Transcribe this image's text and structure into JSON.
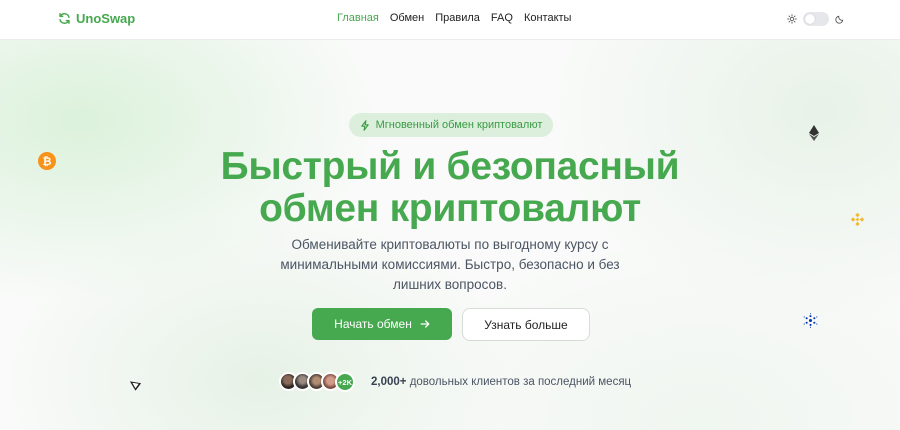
{
  "brand": {
    "name": "UnoSwap",
    "accent": "#47a94f"
  },
  "nav": {
    "items": [
      {
        "label": "Главная",
        "active": true
      },
      {
        "label": "Обмен",
        "active": false
      },
      {
        "label": "Правила",
        "active": false
      },
      {
        "label": "FAQ",
        "active": false
      },
      {
        "label": "Контакты",
        "active": false
      }
    ]
  },
  "theme_toggle": {
    "icons": [
      "sun-icon",
      "moon-icon"
    ],
    "dark_mode": false
  },
  "hero": {
    "badge": "Мгновенный обмен криптовалют",
    "badge_icon": "lightning-icon",
    "title_line1": "Быстрый и безопасный",
    "title_line2": "обмен криптовалют",
    "subtitle": "Обменивайте криптовалюты по выгодному курсу с минимальными комиссиями. Быстро, безопасно и без лишних вопросов.",
    "primary_button": "Начать обмен",
    "secondary_button": "Узнать больше"
  },
  "social_proof": {
    "avatar_count_badge": "+2K",
    "count": "2,000+",
    "text": "довольных клиентов за последний месяц"
  },
  "floating_icons": [
    "bitcoin-icon",
    "ethereum-icon",
    "bnb-icon",
    "cardano-icon",
    "tron-icon"
  ]
}
